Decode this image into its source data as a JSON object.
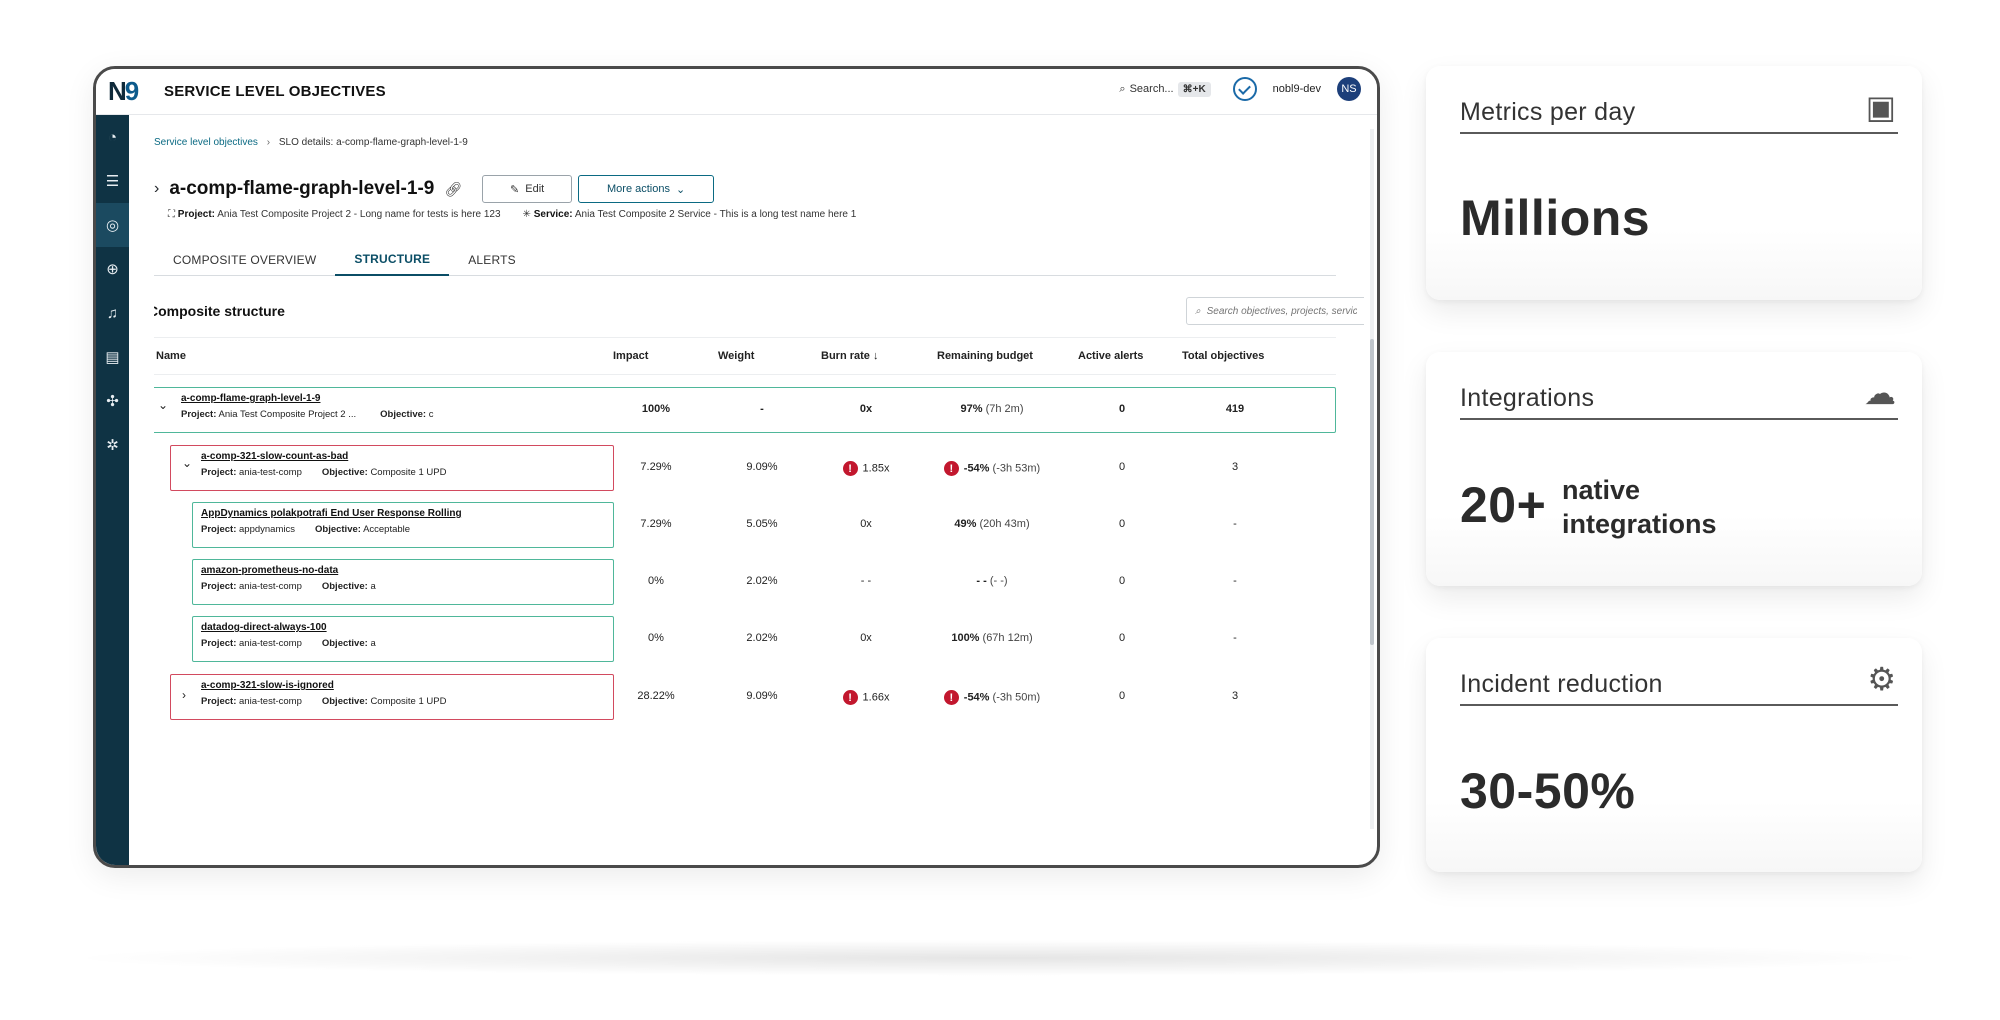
{
  "app": {
    "logo": "N9",
    "title": "SERVICE LEVEL OBJECTIVES",
    "search_label": "Search...",
    "search_kbd": "⌘+K",
    "org": "nobl9-dev",
    "avatar_initials": "NS"
  },
  "breadcrumb": {
    "root": "Service level objectives",
    "current": "SLO details: a-comp-flame-graph-level-1-9"
  },
  "slo": {
    "name": "a-comp-flame-graph-level-1-9",
    "edit_label": "Edit",
    "more_actions_label": "More actions",
    "project_label": "Project:",
    "project_value": "Ania Test Composite Project 2 - Long name for tests is here 123",
    "service_label": "Service:",
    "service_value": "Ania Test Composite 2 Service - This is a long test name here 1"
  },
  "tabs": [
    {
      "label": "COMPOSITE OVERVIEW",
      "active": false
    },
    {
      "label": "STRUCTURE",
      "active": true
    },
    {
      "label": "ALERTS",
      "active": false
    }
  ],
  "structure": {
    "title": "Composite structure",
    "search_placeholder": "Search objectives, projects, service...",
    "columns": [
      "Name",
      "Impact",
      "Weight",
      "Burn rate ↓",
      "Remaining budget",
      "Active alerts",
      "Total objectives"
    ],
    "rows": [
      {
        "name": "a-comp-flame-graph-level-1-9",
        "project_label": "Project:",
        "project": "Ania Test Composite Project 2 ...",
        "objective_label": "Objective:",
        "objective": "c",
        "impact": "100%",
        "weight": "-",
        "burn_rate": "0x",
        "budget_pct": "97%",
        "budget_time": "(7h 2m)",
        "alerts": "0",
        "total": "419",
        "status": "ok",
        "level": 0,
        "expander": "⌄"
      },
      {
        "name": "a-comp-321-slow-count-as-bad",
        "project_label": "Project:",
        "project": "ania-test-comp",
        "objective_label": "Objective:",
        "objective": "Composite 1 UPD",
        "impact": "7.29%",
        "weight": "9.09%",
        "burn_rate": "1.85x",
        "budget_pct": "-54%",
        "budget_time": "(-3h 53m)",
        "alerts": "0",
        "total": "3",
        "status": "bad",
        "level": 1,
        "expander": "⌄"
      },
      {
        "name": "AppDynamics polakpotrafi End User Response Rolling",
        "project_label": "Project:",
        "project": "appdynamics",
        "objective_label": "Objective:",
        "objective": "Acceptable",
        "impact": "7.29%",
        "weight": "5.05%",
        "burn_rate": "0x",
        "budget_pct": "49%",
        "budget_time": "(20h 43m)",
        "alerts": "0",
        "total": "-",
        "status": "ok",
        "level": 2,
        "expander": ""
      },
      {
        "name": "amazon-prometheus-no-data",
        "project_label": "Project:",
        "project": "ania-test-comp",
        "objective_label": "Objective:",
        "objective": "a",
        "impact": "0%",
        "weight": "2.02%",
        "burn_rate": "- -",
        "budget_pct": "- -",
        "budget_time": "(- -)",
        "alerts": "0",
        "total": "-",
        "status": "ok",
        "level": 2,
        "expander": ""
      },
      {
        "name": "datadog-direct-always-100",
        "project_label": "Project:",
        "project": "ania-test-comp",
        "objective_label": "Objective:",
        "objective": "a",
        "impact": "0%",
        "weight": "2.02%",
        "burn_rate": "0x",
        "budget_pct": "100%",
        "budget_time": "(67h 12m)",
        "alerts": "0",
        "total": "-",
        "status": "ok",
        "level": 2,
        "expander": ""
      },
      {
        "name": "a-comp-321-slow-is-ignored",
        "project_label": "Project:",
        "project": "ania-test-comp",
        "objective_label": "Objective:",
        "objective": "Composite 1 UPD",
        "impact": "28.22%",
        "weight": "9.09%",
        "burn_rate": "1.66x",
        "budget_pct": "-54%",
        "budget_time": "(-3h 50m)",
        "alerts": "0",
        "total": "3",
        "status": "bad",
        "level": 1,
        "expander": "›"
      }
    ]
  },
  "metrics": [
    {
      "title": "Metrics per day",
      "value": "Millions",
      "extra": "",
      "icon": "chart-report-icon"
    },
    {
      "title": "Integrations",
      "value": "20+",
      "extra_line1": "native",
      "extra_line2": "integrations",
      "icon": "cloud-sync-icon"
    },
    {
      "title": "Incident reduction",
      "value": "30-50%",
      "extra": "",
      "icon": "chart-down-gear-icon"
    }
  ],
  "colors": {
    "sidebar": "#0f3344",
    "accent": "#0b6a83",
    "ok_border": "#4fb79a",
    "bad_border": "#d24a5f",
    "alert": "#c2172e"
  }
}
